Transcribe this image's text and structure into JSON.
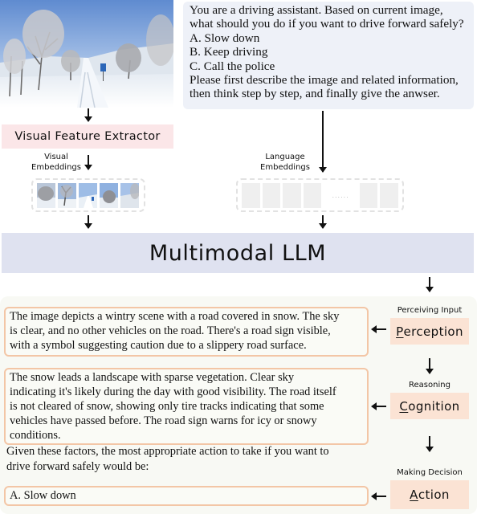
{
  "input_image": {
    "description": "snowy road with trees and a blue road sign"
  },
  "prompt": {
    "lines": [
      "You are a driving assistant.  Based on current image,",
      "what should you do if you want to drive forward safely?",
      "A. Slow down",
      "B. Keep driving",
      "C. Call the police",
      "Please first describe the image and related information,",
      "then think step by step, and finally give the anwser."
    ]
  },
  "visual_feature_extractor": {
    "label": "Visual Feature Extractor"
  },
  "visual_embeddings": {
    "label_line1": "Visual",
    "label_line2": "Embeddings",
    "tile_count": 5
  },
  "language_embeddings": {
    "label_line1": "Language",
    "label_line2": "Embeddings",
    "ellipsis": "......"
  },
  "llm": {
    "label": "Multimodal LLM"
  },
  "stages": [
    {
      "caption": "Perceiving Input",
      "initial": "P",
      "rest": "erception"
    },
    {
      "caption": "Reasoning",
      "initial": "C",
      "rest": "ognition"
    },
    {
      "caption": "Making Decision",
      "initial": "A",
      "rest": "ction"
    }
  ],
  "responses": {
    "perception": [
      "The image depicts a wintry scene with a road covered in snow. The sky",
      "is clear, and no other vehicles on the road. There's a road sign visible,",
      "with a symbol suggesting caution due to a slippery road surface."
    ],
    "cognition": [
      "The snow leads a landscape with sparse vegetation. Clear sky",
      "indicating it's likely during the day with good visibility. The road itself",
      "is not cleared of snow, showing only tire tracks indicating that some",
      "vehicles have passed before. The road sign warns for icy or snowy",
      "conditions."
    ],
    "transition": [
      "Given these factors, the most appropriate action to take if you want to",
      "drive forward safely would be:"
    ],
    "action": "A. Slow down"
  },
  "colors": {
    "prompt_bg": "#eef1f8",
    "extractor_bg": "#fbe6e8",
    "llm_bg": "#dfe2f0",
    "stage_bg": "#fbe3d4",
    "response_border": "#f3c6a6",
    "panel_bg": "#f8f9f4"
  }
}
